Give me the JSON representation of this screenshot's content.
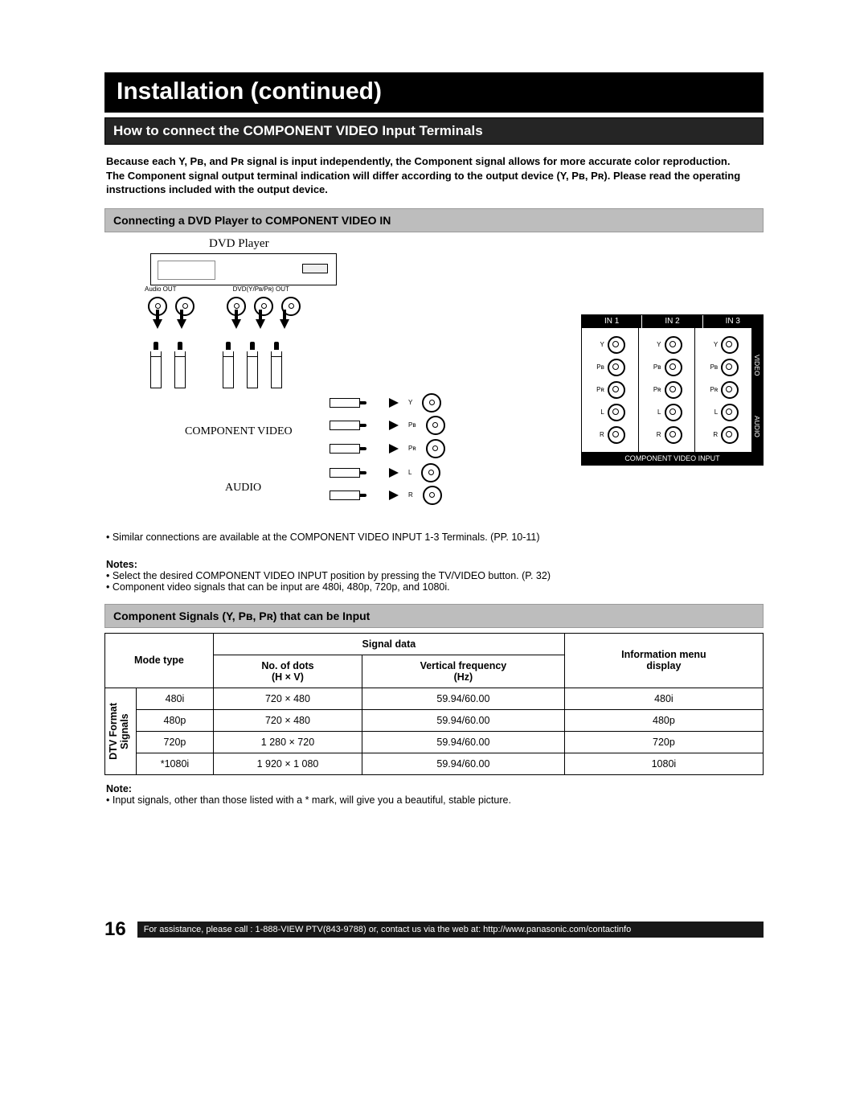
{
  "title": "Installation (continued)",
  "section1": "How to connect the COMPONENT VIDEO Input Terminals",
  "intro": "Because each Y, Pʙ, and Pʀ signal is input independently, the Component signal allows for more accurate color reproduction.\nThe Component signal output terminal indication will differ according to the output device (Y, Pʙ, Pʀ). Please read the operating instructions included with the output device.",
  "sub1": "Connecting a DVD Player to COMPONENT VIDEO IN",
  "labels": {
    "dvd": "DVD Player",
    "compvideo": "COMPONENT VIDEO",
    "audio": "AUDIO",
    "in1": "IN 1",
    "in2": "IN 2",
    "in3": "IN 3",
    "video_side": "VIDEO",
    "audio_side": "AUDIO",
    "panel_footer": "COMPONENT VIDEO INPUT",
    "audio_out": "Audio OUT",
    "dvd_out": "DVD(Y/Pʙ/Pʀ) OUT",
    "Y": "Y",
    "PB": "Pʙ",
    "PR": "Pʀ",
    "L": "L",
    "R": "R"
  },
  "bullet1": "• Similar connections are available at the COMPONENT VIDEO INPUT 1-3 Terminals. (PP. 10-11)",
  "notes": {
    "hd": "Notes:",
    "l1": "• Select the desired COMPONENT VIDEO INPUT position by pressing the TV/VIDEO button. (P. 32)",
    "l2": "• Component video signals that can be input are 480i, 480p, 720p, and 1080i."
  },
  "sub2": "Component Signals (Y, Pʙ, Pʀ) that can be Input",
  "table_headers": {
    "mode": "Mode type",
    "sig": "Signal data",
    "dots": "No. of dots\n(H × V)",
    "vfreq": "Vertical frequency\n(Hz)",
    "info": "Information menu\ndisplay",
    "vhead": "DTV Format\nSignals"
  },
  "chart_data": {
    "type": "table",
    "columns": [
      "Mode type",
      "No. of dots (H × V)",
      "Vertical frequency (Hz)",
      "Information menu display"
    ],
    "rows": [
      {
        "mode": "480i",
        "dots": "720 × 480",
        "vfreq": "59.94/60.00",
        "info": "480i"
      },
      {
        "mode": "480p",
        "dots": "720 × 480",
        "vfreq": "59.94/60.00",
        "info": "480p"
      },
      {
        "mode": "720p",
        "dots": "1 280 × 720",
        "vfreq": "59.94/60.00",
        "info": "720p"
      },
      {
        "mode": "*1080i",
        "dots": "1 920 × 1 080",
        "vfreq": "59.94/60.00",
        "info": "1080i"
      }
    ]
  },
  "note2": {
    "hd": "Note:",
    "l1": "• Input signals, other than those listed with a * mark, will give you a beautiful, stable picture."
  },
  "page_number": "16",
  "footer": "For assistance, please call : 1-888-VIEW PTV(843-9788) or, contact us via the web at: http://www.panasonic.com/contactinfo"
}
